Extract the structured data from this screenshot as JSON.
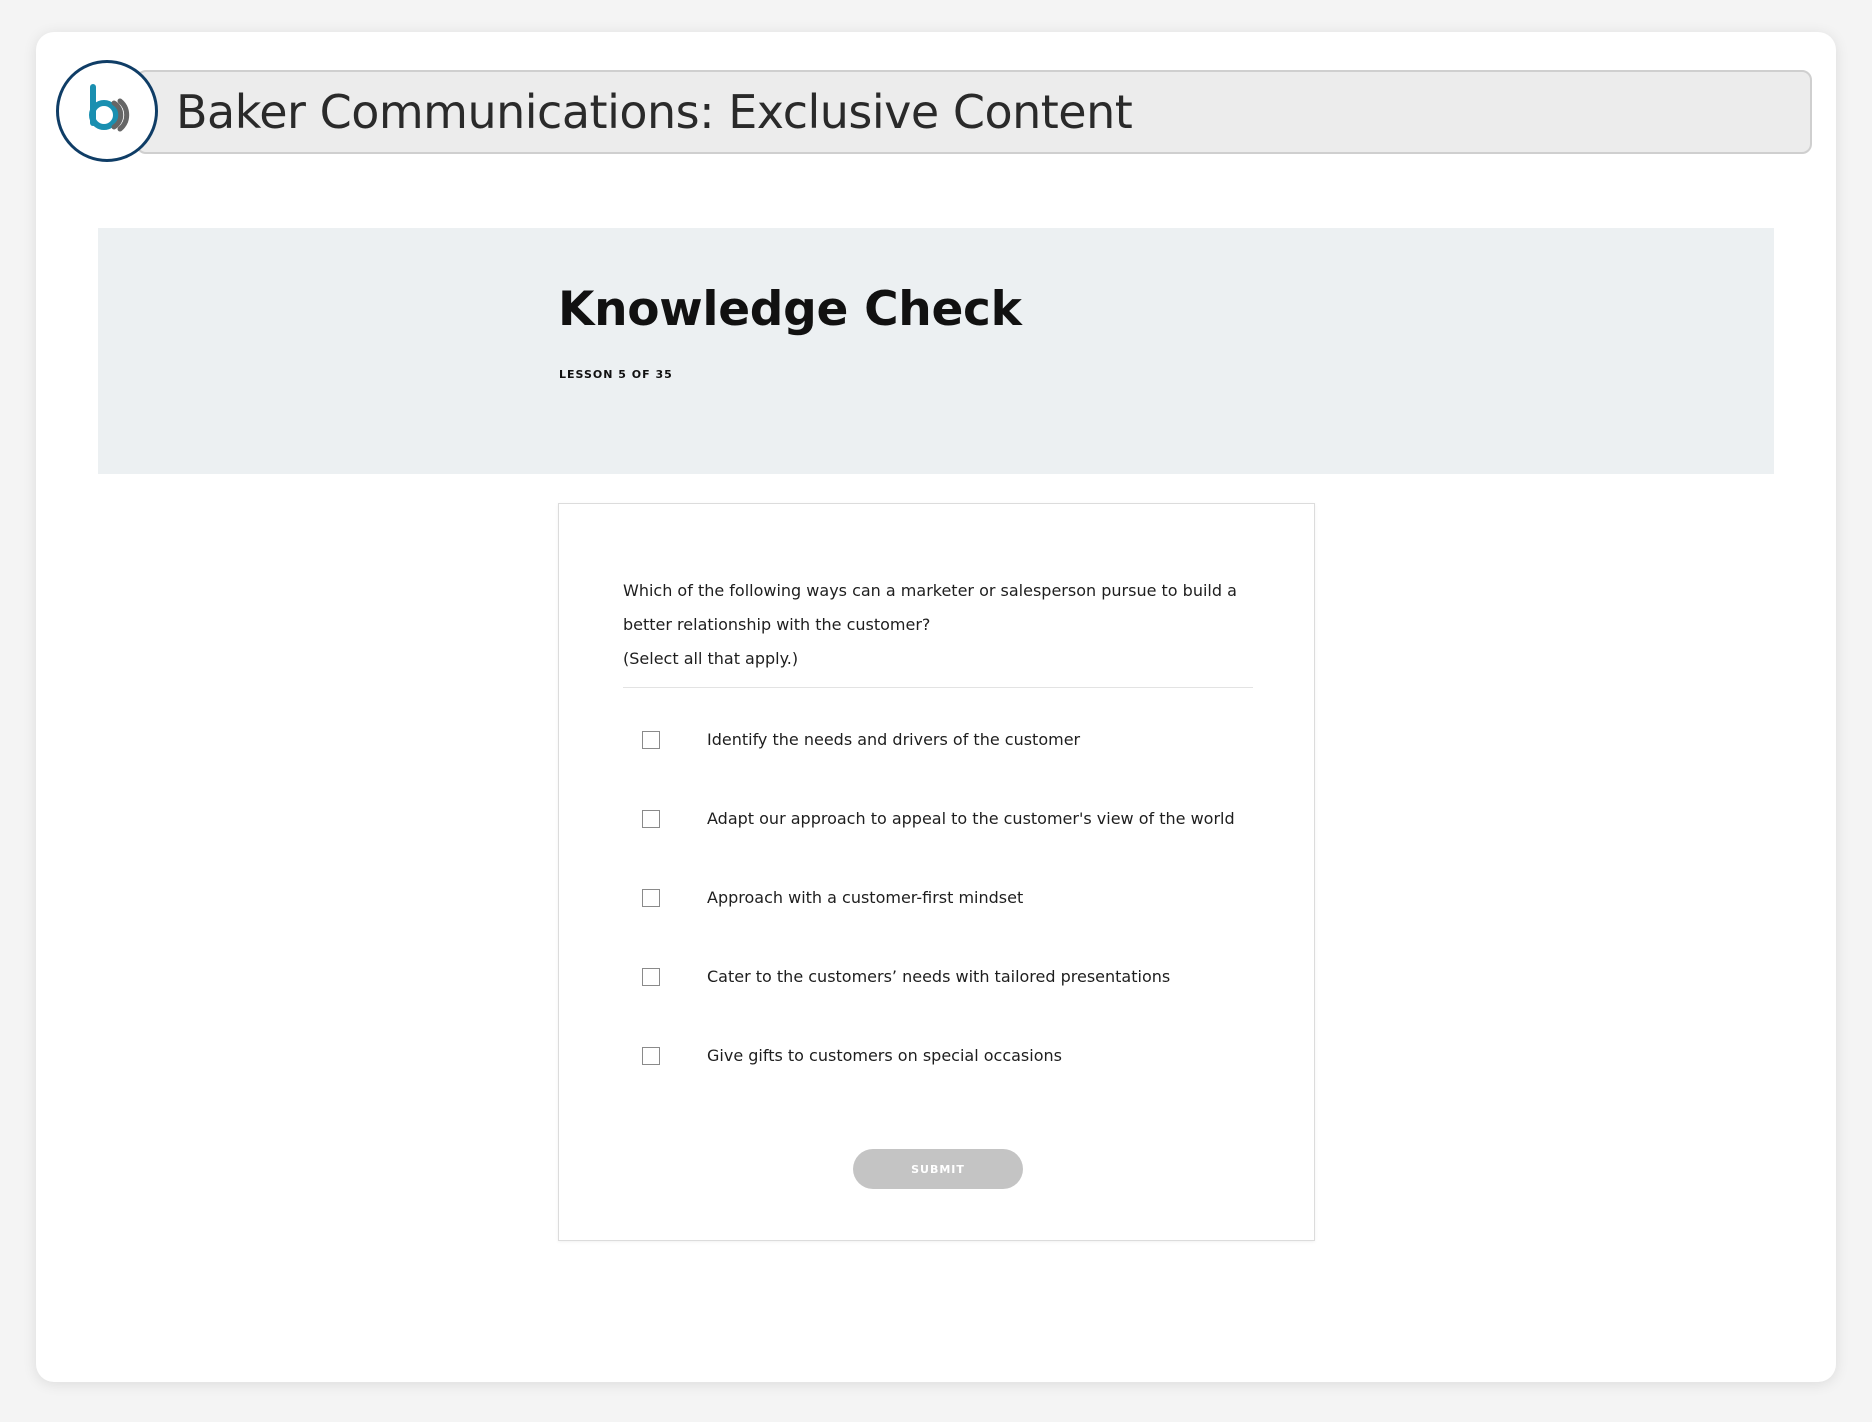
{
  "header": {
    "title": "Baker Communications: Exclusive Content",
    "logo_icon": "baker-b-logo-icon"
  },
  "lesson": {
    "title": "Knowledge Check",
    "progress": "LESSON 5 OF 35"
  },
  "quiz": {
    "question_line1": "Which of the following ways can a marketer or salesperson pursue to build a",
    "question_line2": "better relationship with the customer?",
    "instruction": "(Select all that apply.)",
    "options": [
      {
        "label": "Identify the needs and drivers of the customer",
        "checked": false
      },
      {
        "label": "Adapt our approach to appeal to the customer's view of the world",
        "checked": false
      },
      {
        "label": "Approach with a customer-first mindset",
        "checked": false
      },
      {
        "label": "Cater to the customers’ needs with tailored presentations",
        "checked": false
      },
      {
        "label": "Give gifts to customers on special occasions",
        "checked": false
      }
    ],
    "submit_label": "SUBMIT"
  },
  "colors": {
    "logo_ring": "#0f3d66",
    "logo_b": "#1a8fb0",
    "logo_arc": "#666666",
    "hero_bg": "#ecf0f2",
    "submit_disabled": "#c4c4c4"
  }
}
